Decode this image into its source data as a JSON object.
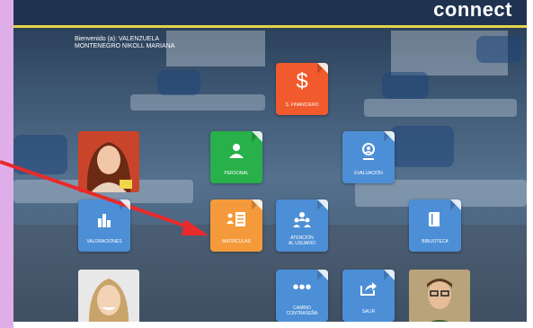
{
  "header": {
    "brand": "connect"
  },
  "welcome": {
    "line1": "Bienvenido (a): VALENZUELA",
    "line2": "MONTENEGRO NIKOLL MARIANA"
  },
  "tiles": {
    "financiero": {
      "icon": "$",
      "label": "S. FINANCIERO",
      "icon_name": "dollar-icon"
    },
    "personal": {
      "icon": "person",
      "label": "PERSONAL",
      "icon_name": "person-icon"
    },
    "evaluacion": {
      "icon": "search-person",
      "label": "EVALUACIÓN",
      "icon_name": "evaluation-icon"
    },
    "valoraciones": {
      "icon": "bars",
      "label": "VALORACIONES",
      "icon_name": "bar-chart-icon"
    },
    "matriculas": {
      "icon": "list",
      "label": "MATRICULAS",
      "icon_name": "enrollment-list-icon"
    },
    "atencion": {
      "label_line1": "ATENCIÓN",
      "label_line2": "AL USUARIO",
      "icon_name": "users-group-icon"
    },
    "biblioteca": {
      "label": "BIBLIOTECA",
      "icon_name": "book-icon"
    },
    "cambio": {
      "label_line1": "CAMBIO",
      "label_line2": "CONTRASEÑA",
      "icon_name": "dots-icon"
    },
    "salir": {
      "label": "SALIR",
      "icon_name": "share-exit-icon"
    }
  },
  "colors": {
    "blue": "#4d8fd6",
    "green": "#28b04a",
    "orange": "#f59a3a",
    "red": "#f05a2c",
    "arrow": "#e82a2a"
  }
}
